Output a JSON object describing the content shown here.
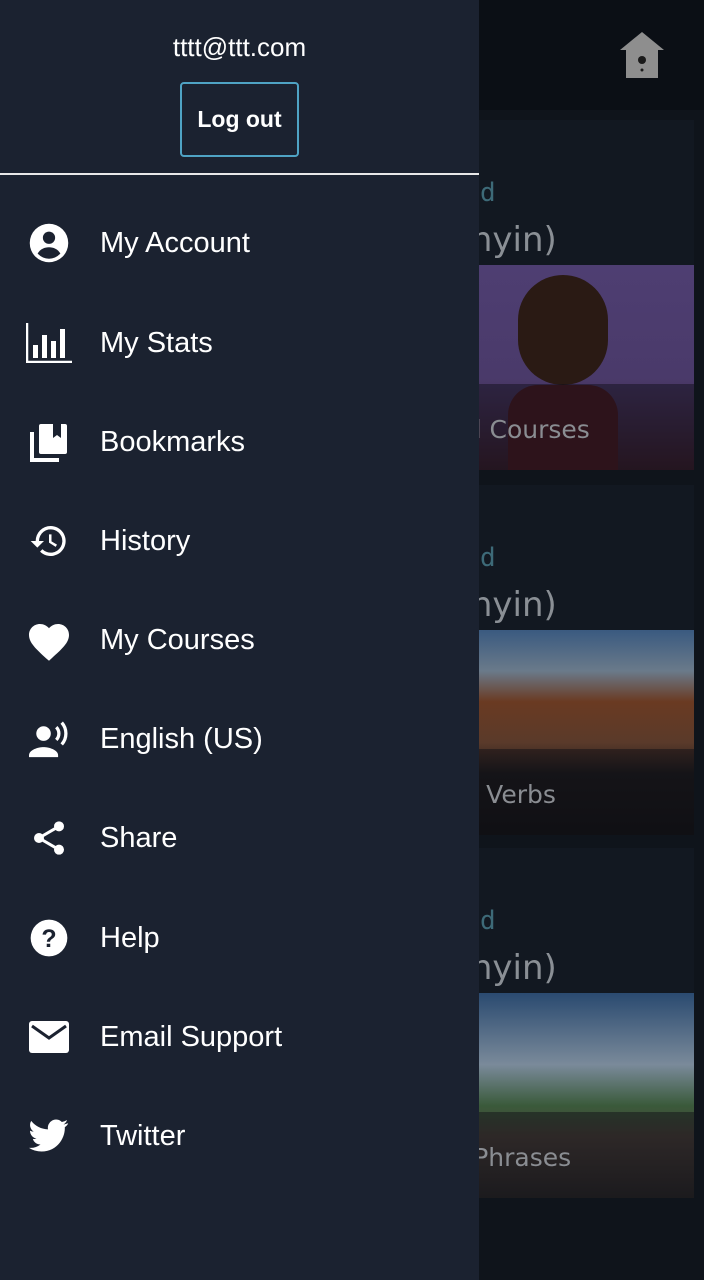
{
  "background": {
    "home_icon": "birdhouse-home-icon",
    "cards": [
      {
        "level": "d",
        "title": "ese (Pinyin)",
        "caption": "alized Courses",
        "image": "woman-with-phone"
      },
      {
        "level": "d",
        "title": "ese (Pinyin)",
        "caption": "ential Verbs",
        "image": "chinese-temple"
      },
      {
        "level": "d",
        "title": "ese (Pinyin)",
        "caption": "erful Phrases",
        "image": "great-wall"
      }
    ]
  },
  "drawer": {
    "email": "tttt@ttt.com",
    "logout_label": "Log out",
    "items": [
      {
        "label": "My Account",
        "icon": "account-circle-icon"
      },
      {
        "label": "My Stats",
        "icon": "bar-chart-icon"
      },
      {
        "label": "Bookmarks",
        "icon": "bookmarks-icon"
      },
      {
        "label": "History",
        "icon": "history-icon"
      },
      {
        "label": "My Courses",
        "icon": "heart-icon"
      },
      {
        "label": "English (US)",
        "icon": "voice-language-icon"
      },
      {
        "label": "Share",
        "icon": "share-icon"
      },
      {
        "label": "Help",
        "icon": "help-icon"
      },
      {
        "label": "Email Support",
        "icon": "mail-icon"
      },
      {
        "label": "Twitter",
        "icon": "twitter-icon"
      }
    ]
  },
  "colors": {
    "drawer_bg": "#1b2230",
    "accent": "#4fa3c4"
  }
}
